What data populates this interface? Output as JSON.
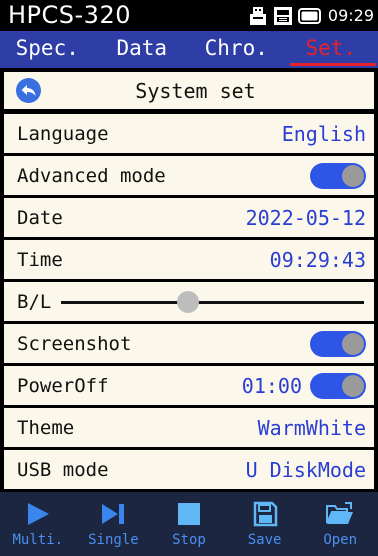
{
  "status": {
    "device": "HPCS-320",
    "time": "09:29",
    "icons": [
      "usb-icon",
      "storage-icon",
      "battery-icon"
    ]
  },
  "tabs": [
    {
      "label": "Spec.",
      "active": false
    },
    {
      "label": "Data",
      "active": false
    },
    {
      "label": "Chro.",
      "active": false
    },
    {
      "label": "Set.",
      "active": true
    }
  ],
  "panel": {
    "title": "System set",
    "language": {
      "label": "Language",
      "value": "English"
    },
    "advanced": {
      "label": "Advanced mode",
      "on": true
    },
    "date": {
      "label": "Date",
      "value": "2022-05-12"
    },
    "time": {
      "label": "Time",
      "value": "09:29:43"
    },
    "backlight": {
      "label": "B/L",
      "level": 0.42
    },
    "screenshot": {
      "label": "Screenshot",
      "on": true
    },
    "poweroff": {
      "label": "PowerOff",
      "value": "01:00",
      "on": true
    },
    "theme": {
      "label": "Theme",
      "value": "WarmWhite"
    },
    "usb": {
      "label": "USB mode",
      "value": "U DiskMode"
    }
  },
  "toolbar": {
    "multi": "Multi.",
    "single": "Single",
    "stop": "Stop",
    "save": "Save",
    "open": "Open"
  },
  "colors": {
    "tab_bar": "#2e3ea6",
    "active_tab": "#e8202c",
    "row_background": "#fbf7ea",
    "value_text": "#2a3ed4",
    "toggle_on": "#2e55e6",
    "toolbar_bg": "#1c2640",
    "toolbar_accent": "#4a8ef0"
  }
}
